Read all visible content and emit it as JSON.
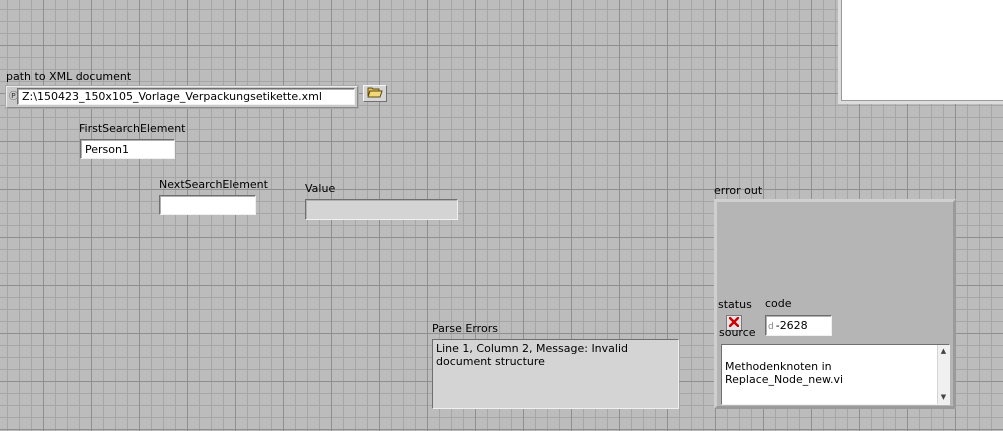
{
  "labels": {
    "path": "path to XML document",
    "first_search": "FirstSearchElement",
    "next_search": "NextSearchElement",
    "value": "Value",
    "error_out": "error out",
    "parse_errors": "Parse Errors",
    "status": "status",
    "code": "code",
    "source": "source"
  },
  "controls": {
    "path_prefix": "Ⓟ",
    "path_value": "Z:\\150423_150x105_Vorlage_Verpackungsetikette.xml",
    "first_search_value": "Person1",
    "next_search_value": "",
    "value_value": "",
    "parse_errors_text": "Line 1, Column 2,  Message: Invalid document structure",
    "code_prefix": "d",
    "code_value": "-2628",
    "source_text": "Methodenknoten in\nReplace_Node_new.vi"
  },
  "icons": {
    "browse": "folder-open-icon",
    "status": "error-x-icon",
    "scroll_up": "scroll-up-arrow-icon",
    "scroll_down": "scroll-down-arrow-icon"
  },
  "colors": {
    "panel_background": "#bcbcbc",
    "grid_major": "#8f8f8f",
    "grid_minor": "#a6a6a6",
    "status_error": "#cc0000"
  }
}
